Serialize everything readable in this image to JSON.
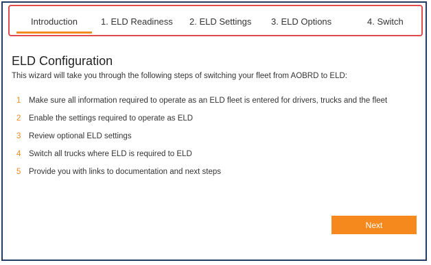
{
  "tabs": [
    {
      "label": "Introduction",
      "active": true
    },
    {
      "label": "1. ELD Readiness",
      "active": false
    },
    {
      "label": "2. ELD Settings",
      "active": false
    },
    {
      "label": "3. ELD Options",
      "active": false
    },
    {
      "label": "4. Switch",
      "active": false
    }
  ],
  "colors": {
    "accent": "#f5891d",
    "highlight_border": "#e04a4a",
    "frame_border": "#1f3b63"
  },
  "main": {
    "title": "ELD Configuration",
    "intro": "This wizard will take you through the following steps of switching your fleet from AOBRD to ELD:",
    "steps": [
      {
        "number": "1",
        "text": "Make sure all information required to operate as an ELD fleet is entered for drivers, trucks and the fleet"
      },
      {
        "number": "2",
        "text": "Enable the settings required to operate as ELD"
      },
      {
        "number": "3",
        "text": "Review optional ELD settings"
      },
      {
        "number": "4",
        "text": "Switch all trucks where ELD is required to ELD"
      },
      {
        "number": "5",
        "text": "Provide you with links to documentation and next steps"
      }
    ],
    "next_label": "Next"
  }
}
